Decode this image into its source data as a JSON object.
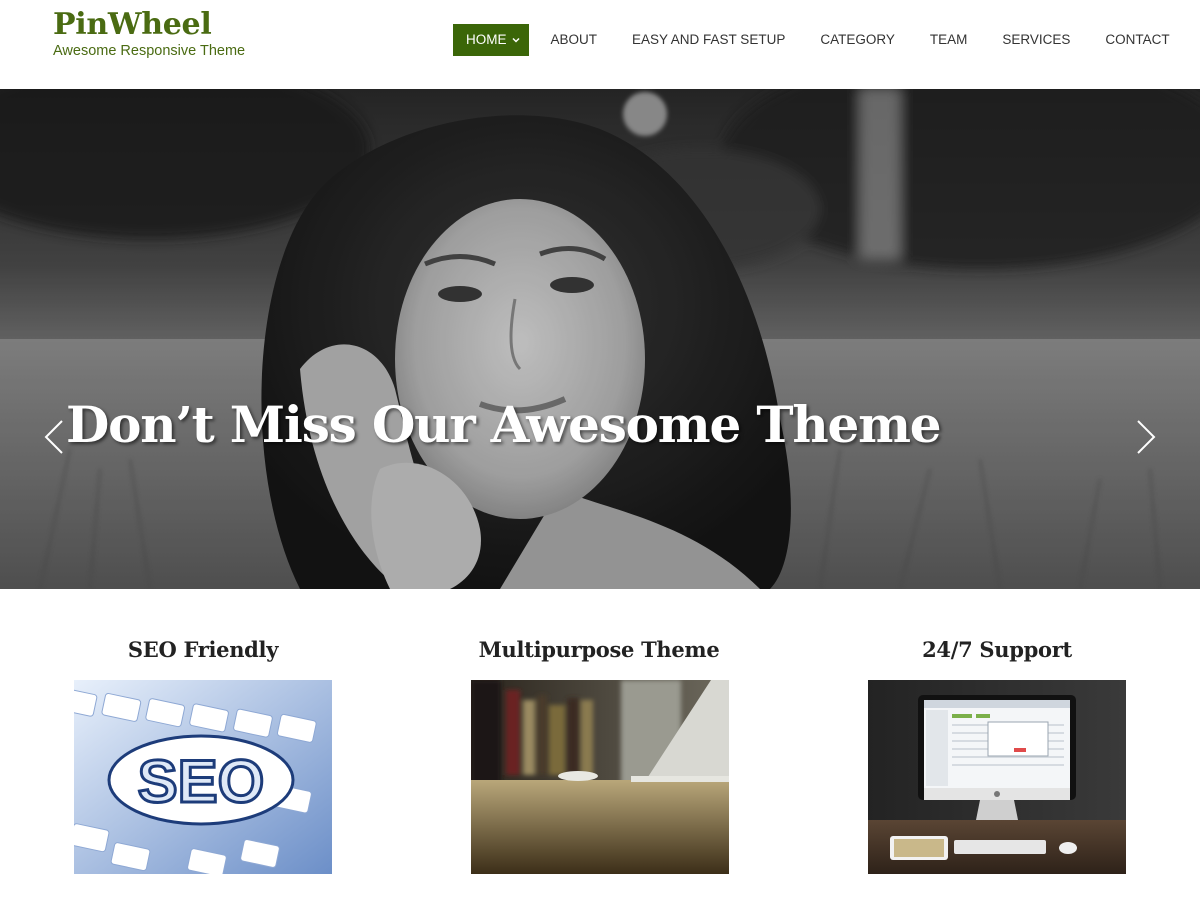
{
  "site": {
    "title": "PinWheel",
    "tagline": "Awesome Responsive Theme"
  },
  "nav": {
    "items": [
      {
        "label": "HOME",
        "active": true
      },
      {
        "label": "ABOUT"
      },
      {
        "label": "EASY AND FAST SETUP"
      },
      {
        "label": "CATEGORY"
      },
      {
        "label": "TEAM"
      },
      {
        "label": "SERVICES"
      },
      {
        "label": "CONTACT"
      }
    ]
  },
  "hero": {
    "caption": "Don’t Miss Our Awesome Theme",
    "prev_icon": "chevron-left-icon",
    "next_icon": "chevron-right-icon"
  },
  "features": [
    {
      "title": "SEO Friendly",
      "image_text": "SEO"
    },
    {
      "title": "Multipurpose Theme"
    },
    {
      "title": "24/7 Support"
    }
  ],
  "colors": {
    "brand": "#4a6b12",
    "nav_active_bg": "#3b6608",
    "nav_text": "#333333",
    "hero_text": "#ffffff"
  }
}
